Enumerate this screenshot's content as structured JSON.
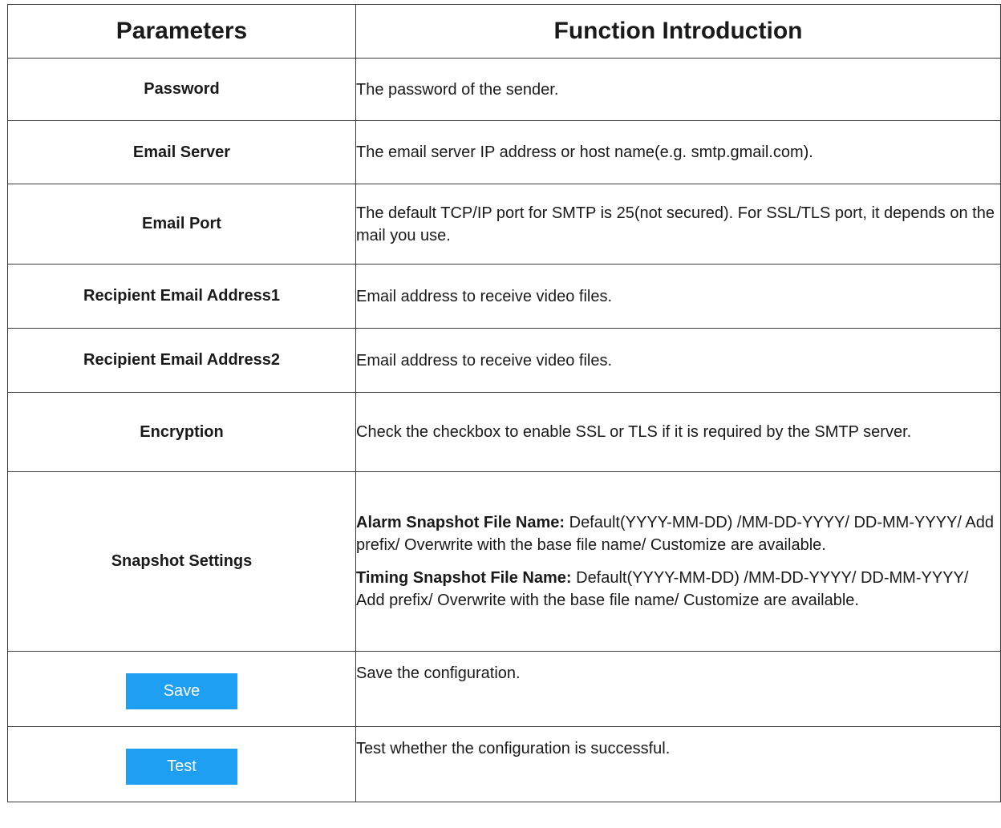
{
  "table": {
    "headers": [
      "Parameters",
      "Function Introduction"
    ],
    "rows": [
      {
        "param": "Password",
        "desc": "The password of the sender."
      },
      {
        "param": "Email Server",
        "desc": "The email server IP address or host name(e.g. smtp.gmail.com)."
      },
      {
        "param": "Email Port",
        "desc": "The default TCP/IP port for SMTP is 25(not secured). For SSL/TLS port, it depends on the mail you use."
      },
      {
        "param": "Recipient Email Address1",
        "desc": "Email address to receive video files."
      },
      {
        "param": "Recipient Email Address2",
        "desc": "Email address to receive video files."
      },
      {
        "param": "Encryption",
        "desc": "Check the checkbox to enable SSL or TLS if it is required by the SMTP server."
      },
      {
        "param": "Snapshot Settings",
        "desc_items": [
          {
            "label": "Alarm Snapshot File Name:",
            "text": " Default(YYYY-MM-DD) /MM-DD-YYYY/ DD-MM-YYYY/ Add prefix/ Overwrite with the base file name/ Customize are available."
          },
          {
            "label": "Timing Snapshot File Name:",
            "text": " Default(YYYY-MM-DD) /MM-DD-YYYY/ DD-MM-YYYY/ Add prefix/ Overwrite with the base file name/ Customize are available."
          }
        ]
      },
      {
        "button_label": "Save",
        "desc": "Save the configuration."
      },
      {
        "button_label": "Test",
        "desc": "Test whether the configuration is successful."
      }
    ]
  },
  "colors": {
    "button_bg": "#1e9ff2",
    "button_text": "#ffffff",
    "border": "#3a3a3a"
  }
}
